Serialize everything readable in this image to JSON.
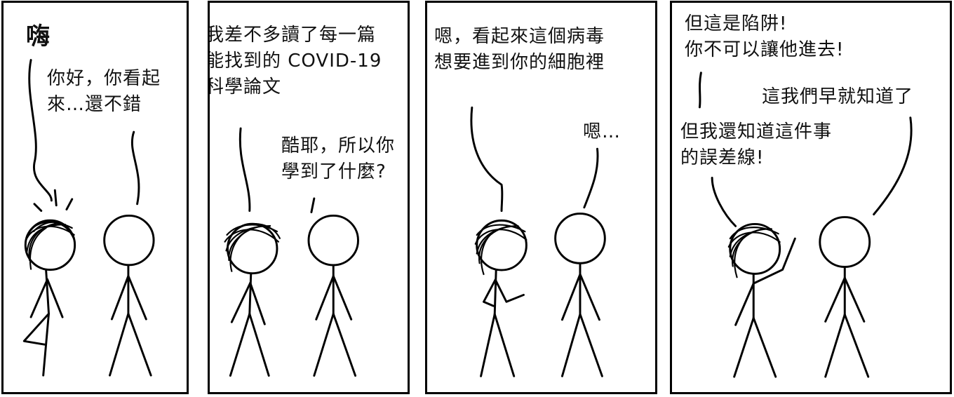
{
  "panels": [
    {
      "exclaim": "嗨",
      "right_speech": "你好，你看起\n來…還不錯"
    },
    {
      "left_speech": "我差不多讀了每一篇\n能找到的 COVID-19\n科學論文",
      "right_speech": "酷耶，所以你\n學到了什麼?"
    },
    {
      "left_speech": "嗯，看起來這個病毒\n想要進到你的細胞裡",
      "right_speech": "嗯…"
    },
    {
      "left_speech_top": "但這是陷阱!\n你不可以讓他進去!",
      "right_speech": "這我們早就知道了",
      "left_speech_bottom": "但我還知道這件事\n的誤差線!"
    }
  ]
}
